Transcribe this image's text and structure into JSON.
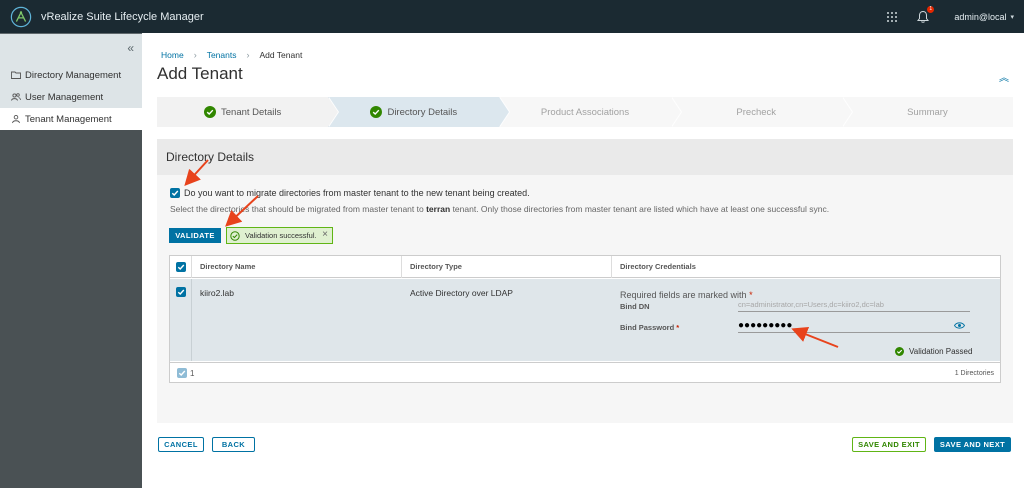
{
  "header": {
    "app_title": "vRealize Suite Lifecycle Manager",
    "notification_count": "1",
    "user": "admin@local"
  },
  "sidebar": {
    "items": [
      {
        "label": "Directory Management",
        "icon": "folder-icon"
      },
      {
        "label": "User Management",
        "icon": "users-icon"
      },
      {
        "label": "Tenant Management",
        "icon": "user-icon"
      }
    ],
    "active_index": 2
  },
  "breadcrumb": {
    "home": "Home",
    "tenants": "Tenants",
    "current": "Add Tenant"
  },
  "page_title": "Add Tenant",
  "steps": [
    {
      "label": "Tenant Details",
      "state": "done"
    },
    {
      "label": "Directory Details",
      "state": "current"
    },
    {
      "label": "Product Associations",
      "state": "upcoming"
    },
    {
      "label": "Precheck",
      "state": "upcoming"
    },
    {
      "label": "Summary",
      "state": "upcoming"
    }
  ],
  "panel": {
    "title": "Directory Details",
    "migrate_label": "Do you want to migrate directories from master tenant to the new tenant being created.",
    "hint_prefix": "Select the directories that should be migrated from master tenant to",
    "hint_tenant": "terran",
    "hint_suffix": "tenant. Only those directories from master tenant are listed which have at least one successful sync.",
    "validate_label": "VALIDATE",
    "validation_message": "Validation successful."
  },
  "table": {
    "columns": [
      "Directory Name",
      "Directory Type",
      "Directory Credentials"
    ],
    "row": {
      "name": "kiiro2.lab",
      "type": "Active Directory over LDAP",
      "required_note": "Required fields are marked with",
      "required_star": "*",
      "bind_dn_label": "Bind DN",
      "bind_dn_placeholder": "cn=administrator,cn=Users,dc=kiiro2,dc=lab",
      "bind_password_label": "Bind Password",
      "bind_password_value": "●●●●●●●●●",
      "validation_status": "Validation Passed"
    },
    "footer_selected": "1",
    "footer_count": "1 Directories"
  },
  "buttons": {
    "cancel": "CANCEL",
    "back": "BACK",
    "save_exit": "SAVE AND EXIT",
    "save_next": "SAVE AND NEXT"
  },
  "colors": {
    "header_bg": "#1b2a32",
    "primary": "#0072a3",
    "success": "#60b515",
    "annotation_arrow": "#e8431c"
  }
}
